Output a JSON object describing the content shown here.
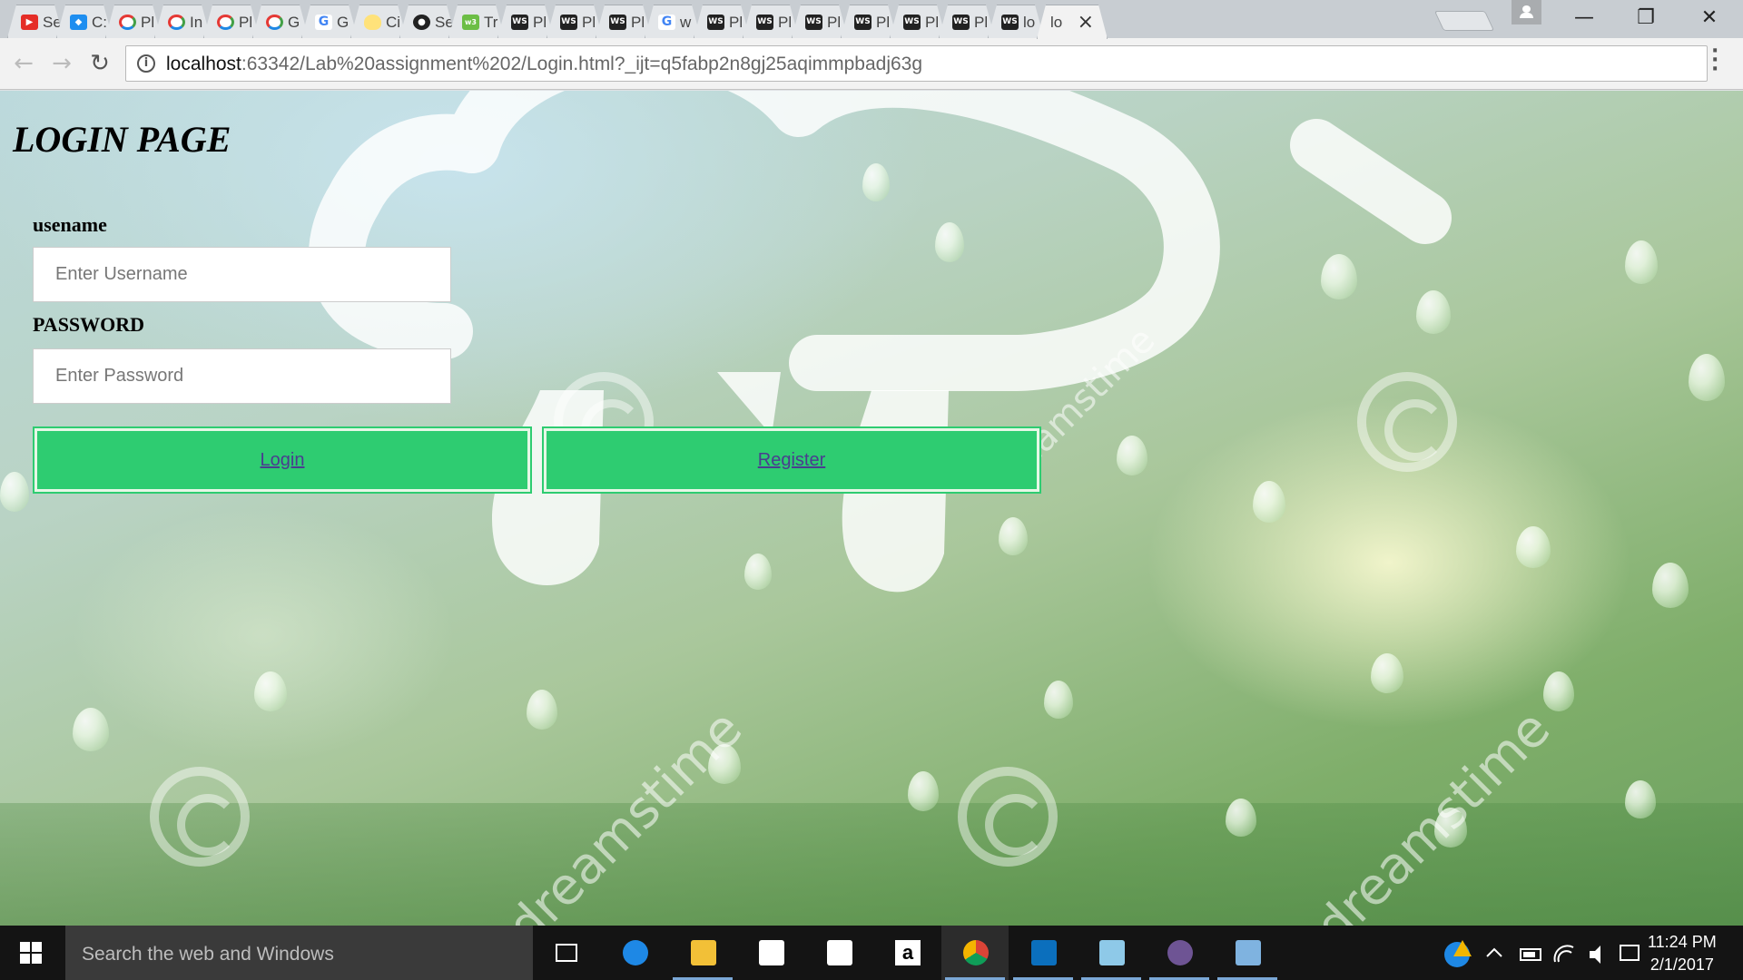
{
  "browser": {
    "tabs": [
      {
        "label": "Se",
        "icon": "youtube-icon"
      },
      {
        "label": "C:",
        "icon": "dropbox-icon"
      },
      {
        "label": "Pl",
        "icon": "pathway-icon"
      },
      {
        "label": "In",
        "icon": "pathway-icon"
      },
      {
        "label": "Pl",
        "icon": "pathway-icon"
      },
      {
        "label": "G",
        "icon": "pathway-icon"
      },
      {
        "label": "G",
        "icon": "google-icon"
      },
      {
        "label": "Ci",
        "icon": "lightbulb-icon"
      },
      {
        "label": "Se",
        "icon": "github-icon"
      },
      {
        "label": "Tr",
        "icon": "w3-icon"
      },
      {
        "label": "Pl",
        "icon": "webstorm-icon"
      },
      {
        "label": "Pl",
        "icon": "webstorm-icon"
      },
      {
        "label": "Pl",
        "icon": "webstorm-icon"
      },
      {
        "label": "w",
        "icon": "google-icon"
      },
      {
        "label": "Pl",
        "icon": "webstorm-icon"
      },
      {
        "label": "Pl",
        "icon": "webstorm-icon"
      },
      {
        "label": "Pl",
        "icon": "webstorm-icon"
      },
      {
        "label": "Pl",
        "icon": "webstorm-icon"
      },
      {
        "label": "Pl",
        "icon": "webstorm-icon"
      },
      {
        "label": "Pl",
        "icon": "webstorm-icon"
      },
      {
        "label": "lo",
        "icon": "webstorm-icon"
      },
      {
        "label": "lo",
        "icon": "",
        "active": true
      }
    ],
    "url_host": "localhost",
    "url_path": ":63342/Lab%20assignment%202/Login.html?_ijt=q5fabp2n8gj25aqimmpbadj63g",
    "window_controls": {
      "minimize": "—",
      "restore": "❐",
      "close": "✕"
    }
  },
  "page": {
    "title": "LOGIN PAGE",
    "username_label": "usename",
    "username_placeholder": "Enter Username",
    "password_label": "PASSWORD",
    "password_placeholder": "Enter Password",
    "login_label": "Login",
    "register_label": "Register",
    "button_color": "#2ecc71",
    "watermark": "dreamstime"
  },
  "taskbar": {
    "search_placeholder": "Search the web and Windows",
    "apps": [
      "task-view-icon",
      "edge-icon",
      "file-explorer-icon",
      "store-icon",
      "dropbox-icon",
      "amazon-icon",
      "chrome-icon",
      "webstorm-icon",
      "notepad-icon",
      "github-icon",
      "paint-icon"
    ],
    "time": "11:24 PM",
    "date": "2/1/2017"
  }
}
